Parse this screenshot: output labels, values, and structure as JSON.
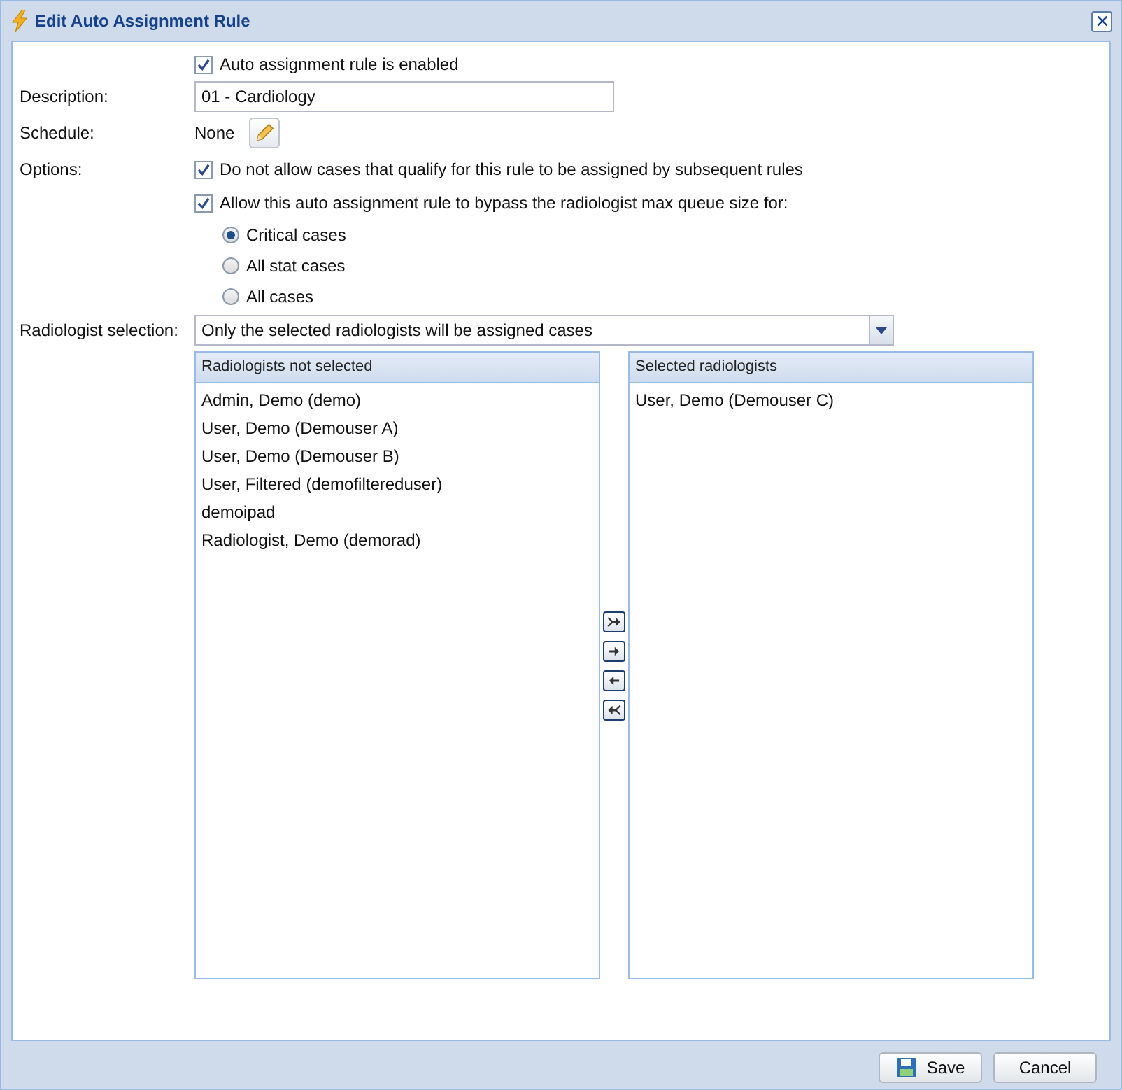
{
  "window": {
    "title": "Edit Auto Assignment Rule"
  },
  "enabled": {
    "label": "Auto assignment rule is enabled",
    "checked": true
  },
  "description": {
    "label": "Description:",
    "value": "01 - Cardiology"
  },
  "schedule": {
    "label": "Schedule:",
    "value": "None"
  },
  "options": {
    "label": "Options:",
    "items": [
      {
        "label": "Do not allow cases that qualify for this rule to be assigned by subsequent rules",
        "checked": true
      },
      {
        "label": "Allow this auto assignment rule to bypass the radiologist max queue size for:",
        "checked": true
      }
    ],
    "radios": [
      {
        "label": "Critical cases",
        "selected": true
      },
      {
        "label": "All stat cases",
        "selected": false
      },
      {
        "label": "All cases",
        "selected": false
      }
    ]
  },
  "radiologist_selection": {
    "label": "Radiologist selection:",
    "value": "Only the selected radiologists will be assigned cases"
  },
  "not_selected": {
    "title": "Radiologists not selected",
    "items": [
      "Admin, Demo (demo)",
      "User, Demo (Demouser A)",
      "User, Demo (Demouser B)",
      "User, Filtered (demofiltereduser)",
      "demoipad",
      "Radiologist, Demo (demorad)"
    ]
  },
  "selected": {
    "title": "Selected radiologists",
    "items": [
      "User, Demo (Demouser C)"
    ]
  },
  "move_buttons": [
    {
      "kind": "all-right"
    },
    {
      "kind": "right"
    },
    {
      "kind": "left"
    },
    {
      "kind": "all-left"
    }
  ],
  "buttons": [
    {
      "kind": "save",
      "label": "Save"
    },
    {
      "kind": "cancel",
      "label": "Cancel"
    }
  ]
}
